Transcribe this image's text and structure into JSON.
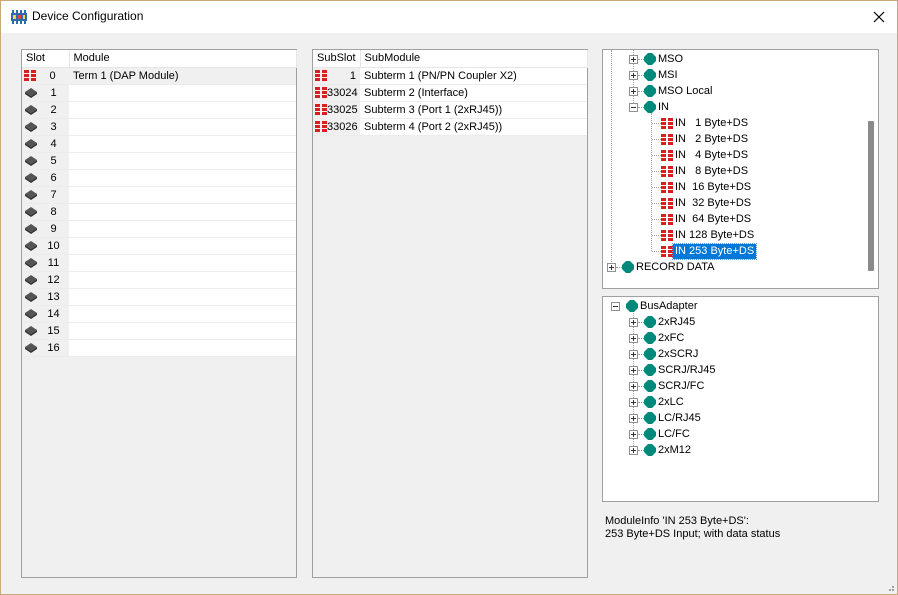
{
  "window": {
    "title": "Device Configuration",
    "close_icon": "close-icon",
    "app_icon": "device-config-icon"
  },
  "slots": {
    "columns": [
      "Slot",
      "Module"
    ],
    "rows": [
      {
        "slot": "0",
        "module": "Term 1 (DAP Module)",
        "icon": "dap-module-icon"
      },
      {
        "slot": "1",
        "module": "",
        "icon": "empty-slot-icon"
      },
      {
        "slot": "2",
        "module": "",
        "icon": "empty-slot-icon"
      },
      {
        "slot": "3",
        "module": "",
        "icon": "empty-slot-icon"
      },
      {
        "slot": "4",
        "module": "",
        "icon": "empty-slot-icon"
      },
      {
        "slot": "5",
        "module": "",
        "icon": "empty-slot-icon"
      },
      {
        "slot": "6",
        "module": "",
        "icon": "empty-slot-icon"
      },
      {
        "slot": "7",
        "module": "",
        "icon": "empty-slot-icon"
      },
      {
        "slot": "8",
        "module": "",
        "icon": "empty-slot-icon"
      },
      {
        "slot": "9",
        "module": "",
        "icon": "empty-slot-icon"
      },
      {
        "slot": "10",
        "module": "",
        "icon": "empty-slot-icon"
      },
      {
        "slot": "11",
        "module": "",
        "icon": "empty-slot-icon"
      },
      {
        "slot": "12",
        "module": "",
        "icon": "empty-slot-icon"
      },
      {
        "slot": "13",
        "module": "",
        "icon": "empty-slot-icon"
      },
      {
        "slot": "14",
        "module": "",
        "icon": "empty-slot-icon"
      },
      {
        "slot": "15",
        "module": "",
        "icon": "empty-slot-icon"
      },
      {
        "slot": "16",
        "module": "",
        "icon": "empty-slot-icon"
      }
    ]
  },
  "subslots": {
    "columns": [
      "SubSlot",
      "SubModule"
    ],
    "rows": [
      {
        "subslot": "1",
        "submodule": "Subterm 1 (PN/PN Coupler X2)",
        "icon": "submodule-icon"
      },
      {
        "subslot": "33024",
        "submodule": "Subterm 2 (Interface)",
        "icon": "submodule-icon"
      },
      {
        "subslot": "33025",
        "submodule": "Subterm 3 (Port 1 (2xRJ45))",
        "icon": "submodule-icon"
      },
      {
        "subslot": "33026",
        "submodule": "Subterm 4 (Port 2 (2xRJ45))",
        "icon": "submodule-icon"
      }
    ]
  },
  "module_tree": {
    "items": [
      {
        "label": "MSO",
        "type": "group",
        "expand": "plus"
      },
      {
        "label": "MSI",
        "type": "group",
        "expand": "plus"
      },
      {
        "label": "MSO Local",
        "type": "group",
        "expand": "plus"
      },
      {
        "label": "IN",
        "type": "group",
        "expand": "minus"
      },
      {
        "label": "IN   1 Byte+DS",
        "type": "module"
      },
      {
        "label": "IN   2 Byte+DS",
        "type": "module"
      },
      {
        "label": "IN   4 Byte+DS",
        "type": "module"
      },
      {
        "label": "IN   8 Byte+DS",
        "type": "module"
      },
      {
        "label": "IN  16 Byte+DS",
        "type": "module"
      },
      {
        "label": "IN  32 Byte+DS",
        "type": "module"
      },
      {
        "label": "IN  64 Byte+DS",
        "type": "module"
      },
      {
        "label": "IN 128 Byte+DS",
        "type": "module"
      },
      {
        "label": "IN 253 Byte+DS",
        "type": "module",
        "selected": true
      },
      {
        "label": "RECORD DATA",
        "type": "root",
        "expand": "plus"
      }
    ]
  },
  "bus_tree": {
    "root": "BusAdapter",
    "items": [
      "2xRJ45",
      "2xFC",
      "2xSCRJ",
      "SCRJ/RJ45",
      "SCRJ/FC",
      "2xLC",
      "LC/RJ45",
      "LC/FC",
      "2xM12"
    ]
  },
  "info": {
    "line1": "ModuleInfo 'IN 253 Byte+DS':",
    "line2": "253 Byte+DS Input; with data status"
  },
  "colors": {
    "selection": "#0078d7",
    "module_red": "#d81e1e",
    "node_teal": "#00897b",
    "border": "#a0a0a0"
  }
}
